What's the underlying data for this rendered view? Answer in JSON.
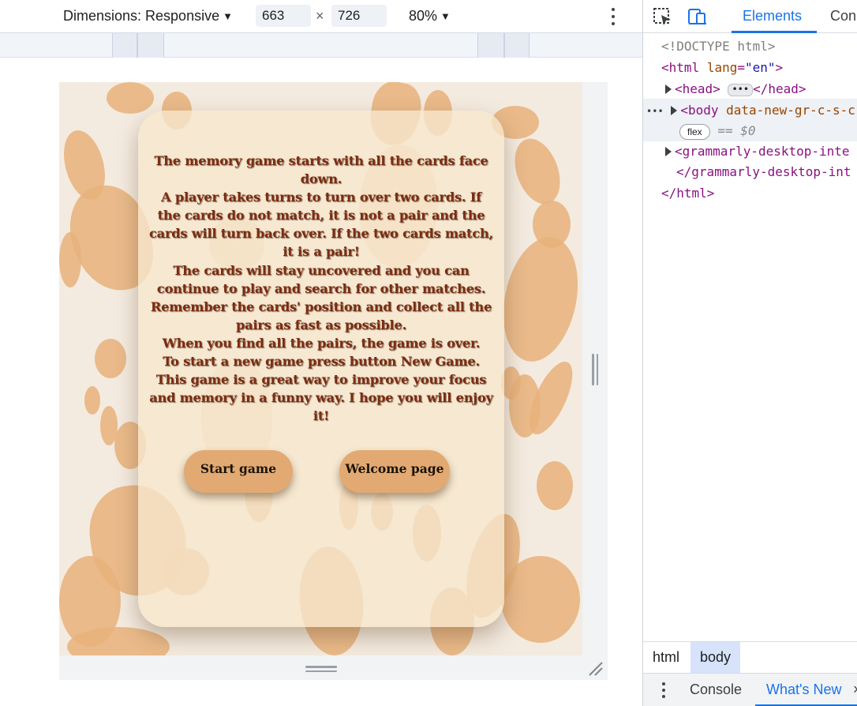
{
  "device_toolbar": {
    "dimensions_label": "Dimensions: Responsive",
    "width_value": "663",
    "times_sign": "×",
    "height_value": "726",
    "zoom_label": "80%"
  },
  "page": {
    "instructions": [
      "The memory game starts with all the cards face down.",
      "A player takes turns to turn over two cards. If the cards do not match, it is not a pair and the cards will turn back over. If the two cards match, it is a pair!",
      "The cards will stay uncovered and you can continue to play and search for other matches.",
      "Remember the cards' position and collect all the pairs as fast as possible.",
      "When you find all the pairs, the game is over.",
      "To start a new game press button New Game.",
      "This game is a great way to improve your focus and memory in a funny way. I hope you will enjoy it!"
    ],
    "start_button": "Start game",
    "welcome_button": "Welcome page",
    "colors": {
      "background": "#f4ebe0",
      "paw": "#e8b27a",
      "card": "#f6e7cd",
      "text": "#7a2d12",
      "button": "#e2aa72"
    }
  },
  "devtools": {
    "tabs": [
      "Elements",
      "Con"
    ],
    "active_tab": "Elements",
    "dom": {
      "doctype": "<!DOCTYPE html>",
      "html_open_tag": "<html",
      "html_lang_attr": "lang",
      "html_lang_val": "\"en\"",
      "head_open": "<head>",
      "head_close": "</head>",
      "ellipsis": "•••",
      "row_dots": "•••",
      "body_open": "<body",
      "body_attr": "data-new-gr-c-s-c",
      "flex_badge": "flex",
      "dollar_zero": "== $0",
      "grammarly_open": "<grammarly-desktop-inte",
      "grammarly_close": "</grammarly-desktop-int",
      "html_close": "</html>"
    },
    "breadcrumbs": [
      "html",
      "body"
    ],
    "drawer_tabs": [
      "Console",
      "What's New"
    ],
    "drawer_close": "×"
  }
}
